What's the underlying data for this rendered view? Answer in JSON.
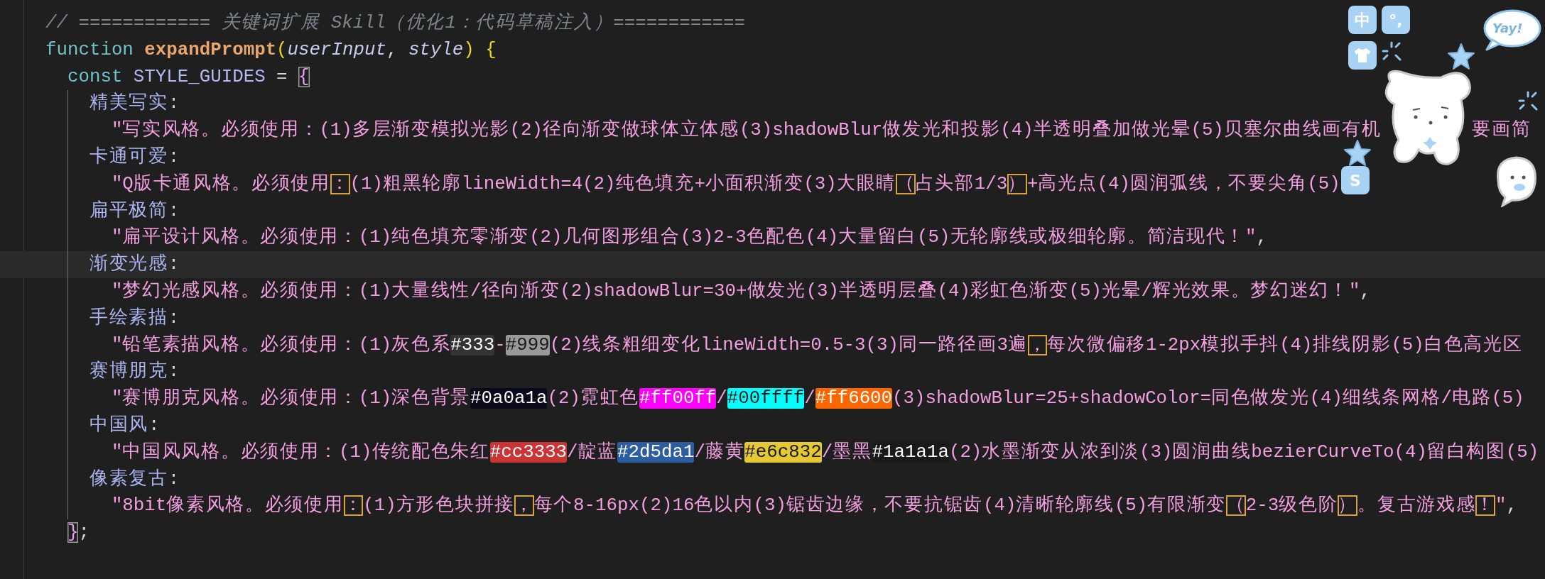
{
  "editor": {
    "lines": [
      {
        "current": false,
        "tokens": [
          {
            "text": "// ============ 关键词扩展 Skill（优化1：代码草稿注入）============",
            "kind": "comment"
          }
        ]
      },
      {
        "current": false,
        "tokens": [
          {
            "text": "function",
            "kind": "keyword"
          },
          {
            "text": " expandPrompt",
            "kind": "fn"
          },
          {
            "text": "(",
            "kind": "paren"
          },
          {
            "text": "userInput",
            "kind": "param"
          },
          {
            "text": ",",
            "kind": "plain"
          },
          {
            "text": " style",
            "kind": "param"
          },
          {
            "text": ")",
            "kind": "paren"
          },
          {
            "text": " {",
            "kind": "paren"
          }
        ]
      },
      {
        "current": false,
        "tokens": [
          {
            "text": "  const",
            "kind": "keyword"
          },
          {
            "text": " STYLE_GUIDES",
            "kind": "var"
          },
          {
            "text": " = ",
            "kind": "plain"
          },
          {
            "text": "{",
            "kind": "match"
          }
        ]
      },
      {
        "current": false,
        "tokens": [
          {
            "text": "    精美写实",
            "kind": "key"
          },
          {
            "text": ":",
            "kind": "plain"
          }
        ]
      },
      {
        "current": false,
        "tokens": [
          {
            "text": "      \"写实风格。必须使用：(1)多层渐变模拟光影(2)径向渐变做球体立体感(3)shadowBlur做发光和投影(4)半透明叠加做光晕(5)贝塞尔曲线画有机",
            "kind": "string"
          },
          {
            "kind": "occluded"
          },
          {
            "text": "要画简",
            "kind": "string"
          }
        ]
      },
      {
        "current": false,
        "tokens": [
          {
            "text": "    卡通可爱",
            "kind": "key"
          },
          {
            "text": ":",
            "kind": "plain"
          }
        ]
      },
      {
        "current": false,
        "tokens": [
          {
            "text": "      \"Q版卡通风格。必须使用",
            "kind": "string"
          },
          {
            "text": "：",
            "kind": "amb"
          },
          {
            "text": "(1)粗黑轮廓lineWidth=4(2)纯色填充+小面积渐变(3)大眼睛",
            "kind": "string"
          },
          {
            "text": "（",
            "kind": "amb"
          },
          {
            "text": "占头部1/3",
            "kind": "string"
          },
          {
            "text": "）",
            "kind": "amb"
          },
          {
            "text": "+高光点(4)圆润弧线，不要尖角(5)",
            "kind": "string"
          }
        ]
      },
      {
        "current": false,
        "tokens": [
          {
            "text": "    扁平极简",
            "kind": "key"
          },
          {
            "text": ":",
            "kind": "plain"
          }
        ]
      },
      {
        "current": false,
        "tokens": [
          {
            "text": "      \"扁平设计风格。必须使用：(1)纯色填充零渐变(2)几何图形组合(3)2-3色配色(4)大量留白(5)无轮廓线或极细轮廓。简洁现代！\"",
            "kind": "string"
          },
          {
            "text": ",",
            "kind": "plain"
          }
        ]
      },
      {
        "current": true,
        "tokens": [
          {
            "text": "    渐变光感",
            "kind": "key"
          },
          {
            "text": ":",
            "kind": "plain"
          }
        ]
      },
      {
        "current": false,
        "tokens": [
          {
            "text": "      \"梦幻光感风格。必须使用：(1)大量线性/径向渐变(2)shadowBlur=30+做发光(3)半透明层叠(4)彩虹色渐变(5)光晕/辉光效果。梦幻迷幻！\"",
            "kind": "string"
          },
          {
            "text": ",",
            "kind": "plain"
          }
        ]
      },
      {
        "current": false,
        "tokens": [
          {
            "text": "    手绘素描",
            "kind": "key"
          },
          {
            "text": ":",
            "kind": "plain"
          }
        ]
      },
      {
        "current": false,
        "tokens": [
          {
            "text": "      \"铅笔素描风格。必须使用：(1)灰色系",
            "kind": "string"
          },
          {
            "text": "#333",
            "kind": "color",
            "color": "#333333"
          },
          {
            "text": "-",
            "kind": "string"
          },
          {
            "text": "#999",
            "kind": "color",
            "color": "#999999"
          },
          {
            "text": "(2)线条粗细变化lineWidth=0.5-3(3)同一路径画3遍",
            "kind": "string"
          },
          {
            "text": "，",
            "kind": "amb"
          },
          {
            "text": "每次微偏移1-2px模拟手抖(4)排线阴影(5)白色高光区",
            "kind": "string"
          }
        ]
      },
      {
        "current": false,
        "tokens": [
          {
            "text": "    赛博朋克",
            "kind": "key"
          },
          {
            "text": ":",
            "kind": "plain"
          }
        ]
      },
      {
        "current": false,
        "tokens": [
          {
            "text": "      \"赛博朋克风格。必须使用：(1)深色背景",
            "kind": "string"
          },
          {
            "text": "#0a0a1a",
            "kind": "color",
            "color": "#0a0a1a"
          },
          {
            "text": "(2)霓虹色",
            "kind": "string"
          },
          {
            "text": "#ff00ff",
            "kind": "color",
            "color": "#ff00ff"
          },
          {
            "text": "/",
            "kind": "string"
          },
          {
            "text": "#00ffff",
            "kind": "color",
            "color": "#00ffff"
          },
          {
            "text": "/",
            "kind": "string"
          },
          {
            "text": "#ff6600",
            "kind": "color",
            "color": "#ff6600"
          },
          {
            "text": "(3)shadowBlur=25+shadowColor=同色做发光(4)细线条网格/电路(5)",
            "kind": "string"
          }
        ]
      },
      {
        "current": false,
        "tokens": [
          {
            "text": "    中国风",
            "kind": "key"
          },
          {
            "text": ":",
            "kind": "plain"
          }
        ]
      },
      {
        "current": false,
        "tokens": [
          {
            "text": "      \"中国风风格。必须使用：(1)传统配色朱红",
            "kind": "string"
          },
          {
            "text": "#cc3333",
            "kind": "color",
            "color": "#cc3333"
          },
          {
            "text": "/靛蓝",
            "kind": "string"
          },
          {
            "text": "#2d5da1",
            "kind": "color",
            "color": "#2d5da1"
          },
          {
            "text": "/藤黄",
            "kind": "string"
          },
          {
            "text": "#e6c832",
            "kind": "color",
            "color": "#e6c832"
          },
          {
            "text": "/墨黑",
            "kind": "string"
          },
          {
            "text": "#1a1a1a",
            "kind": "color",
            "color": "#1a1a1a"
          },
          {
            "text": "(2)水墨渐变从浓到淡(3)圆润曲线bezierCurveTo(4)留白构图(5)",
            "kind": "string"
          }
        ]
      },
      {
        "current": false,
        "tokens": [
          {
            "text": "    像素复古",
            "kind": "key"
          },
          {
            "text": ":",
            "kind": "plain"
          }
        ]
      },
      {
        "current": false,
        "tokens": [
          {
            "text": "      \"8bit像素风格。必须使用",
            "kind": "string"
          },
          {
            "text": "：",
            "kind": "amb"
          },
          {
            "text": "(1)方形色块拼接",
            "kind": "string"
          },
          {
            "text": "，",
            "kind": "amb"
          },
          {
            "text": "每个8-16px(2)16色以内(3)锯齿边缘，不要抗锯齿(4)清晰轮廓线(5)有限渐变",
            "kind": "string"
          },
          {
            "text": "（",
            "kind": "amb"
          },
          {
            "text": "2-3级色阶",
            "kind": "string"
          },
          {
            "text": "）",
            "kind": "amb"
          },
          {
            "text": "。复古游戏感",
            "kind": "string"
          },
          {
            "text": "！",
            "kind": "amb"
          },
          {
            "text": "\"",
            "kind": "string"
          },
          {
            "text": ",",
            "kind": "plain"
          }
        ]
      },
      {
        "current": false,
        "tokens": [
          {
            "text": "  }",
            "kind": "match"
          },
          {
            "text": ";",
            "kind": "plain"
          }
        ]
      }
    ]
  },
  "ime_toolbar": {
    "buttons": [
      {
        "kind": "text",
        "label": "中"
      },
      {
        "kind": "text",
        "label": "°,"
      },
      {
        "kind": "shirt"
      },
      {
        "kind": "text",
        "label": "S"
      }
    ]
  },
  "sticker": {
    "bubble": "Yay!"
  }
}
